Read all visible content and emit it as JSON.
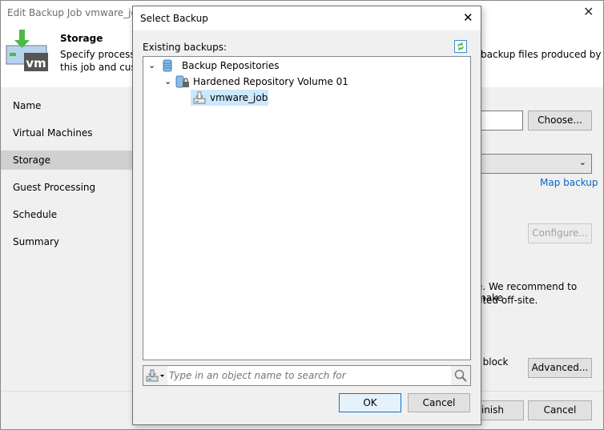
{
  "window": {
    "title": "Edit Backup Job vmware_job"
  },
  "header": {
    "title": "Storage",
    "desc_line1": "Specify processing",
    "desc_line2": "this job and custo",
    "desc_right": "backup files produced by",
    "logo_text": "vm"
  },
  "nav": [
    {
      "label": "Name"
    },
    {
      "label": "Virtual Machines"
    },
    {
      "label": "Storage",
      "selected": true
    },
    {
      "label": "Guest Processing"
    },
    {
      "label": "Schedule"
    },
    {
      "label": "Summary"
    }
  ],
  "content": {
    "choose_label": "Choose...",
    "map_backup_label": "Map backup",
    "configure_label": "Configure...",
    "recommend_line1": "e. We recommend to make",
    "recommend_line2": "ated off-site.",
    "block_text": ", block",
    "advanced_label": "Advanced..."
  },
  "footer": {
    "finish_label": "Finish",
    "cancel_label": "Cancel"
  },
  "dialog": {
    "title": "Select Backup",
    "existing_label": "Existing backups:",
    "tree": [
      {
        "label": "Backup Repositories",
        "level": 0,
        "expanded": true
      },
      {
        "label": "Hardened Repository Volume 01",
        "level": 1,
        "expanded": true
      },
      {
        "label": "vmware_job",
        "level": 2,
        "selected": true
      }
    ],
    "search_placeholder": "Type in an object name to search for",
    "ok_label": "OK",
    "cancel_label": "Cancel"
  },
  "colors": {
    "selection": "#cce8ff",
    "link": "#0066cc",
    "accent_green": "#4cb848"
  }
}
